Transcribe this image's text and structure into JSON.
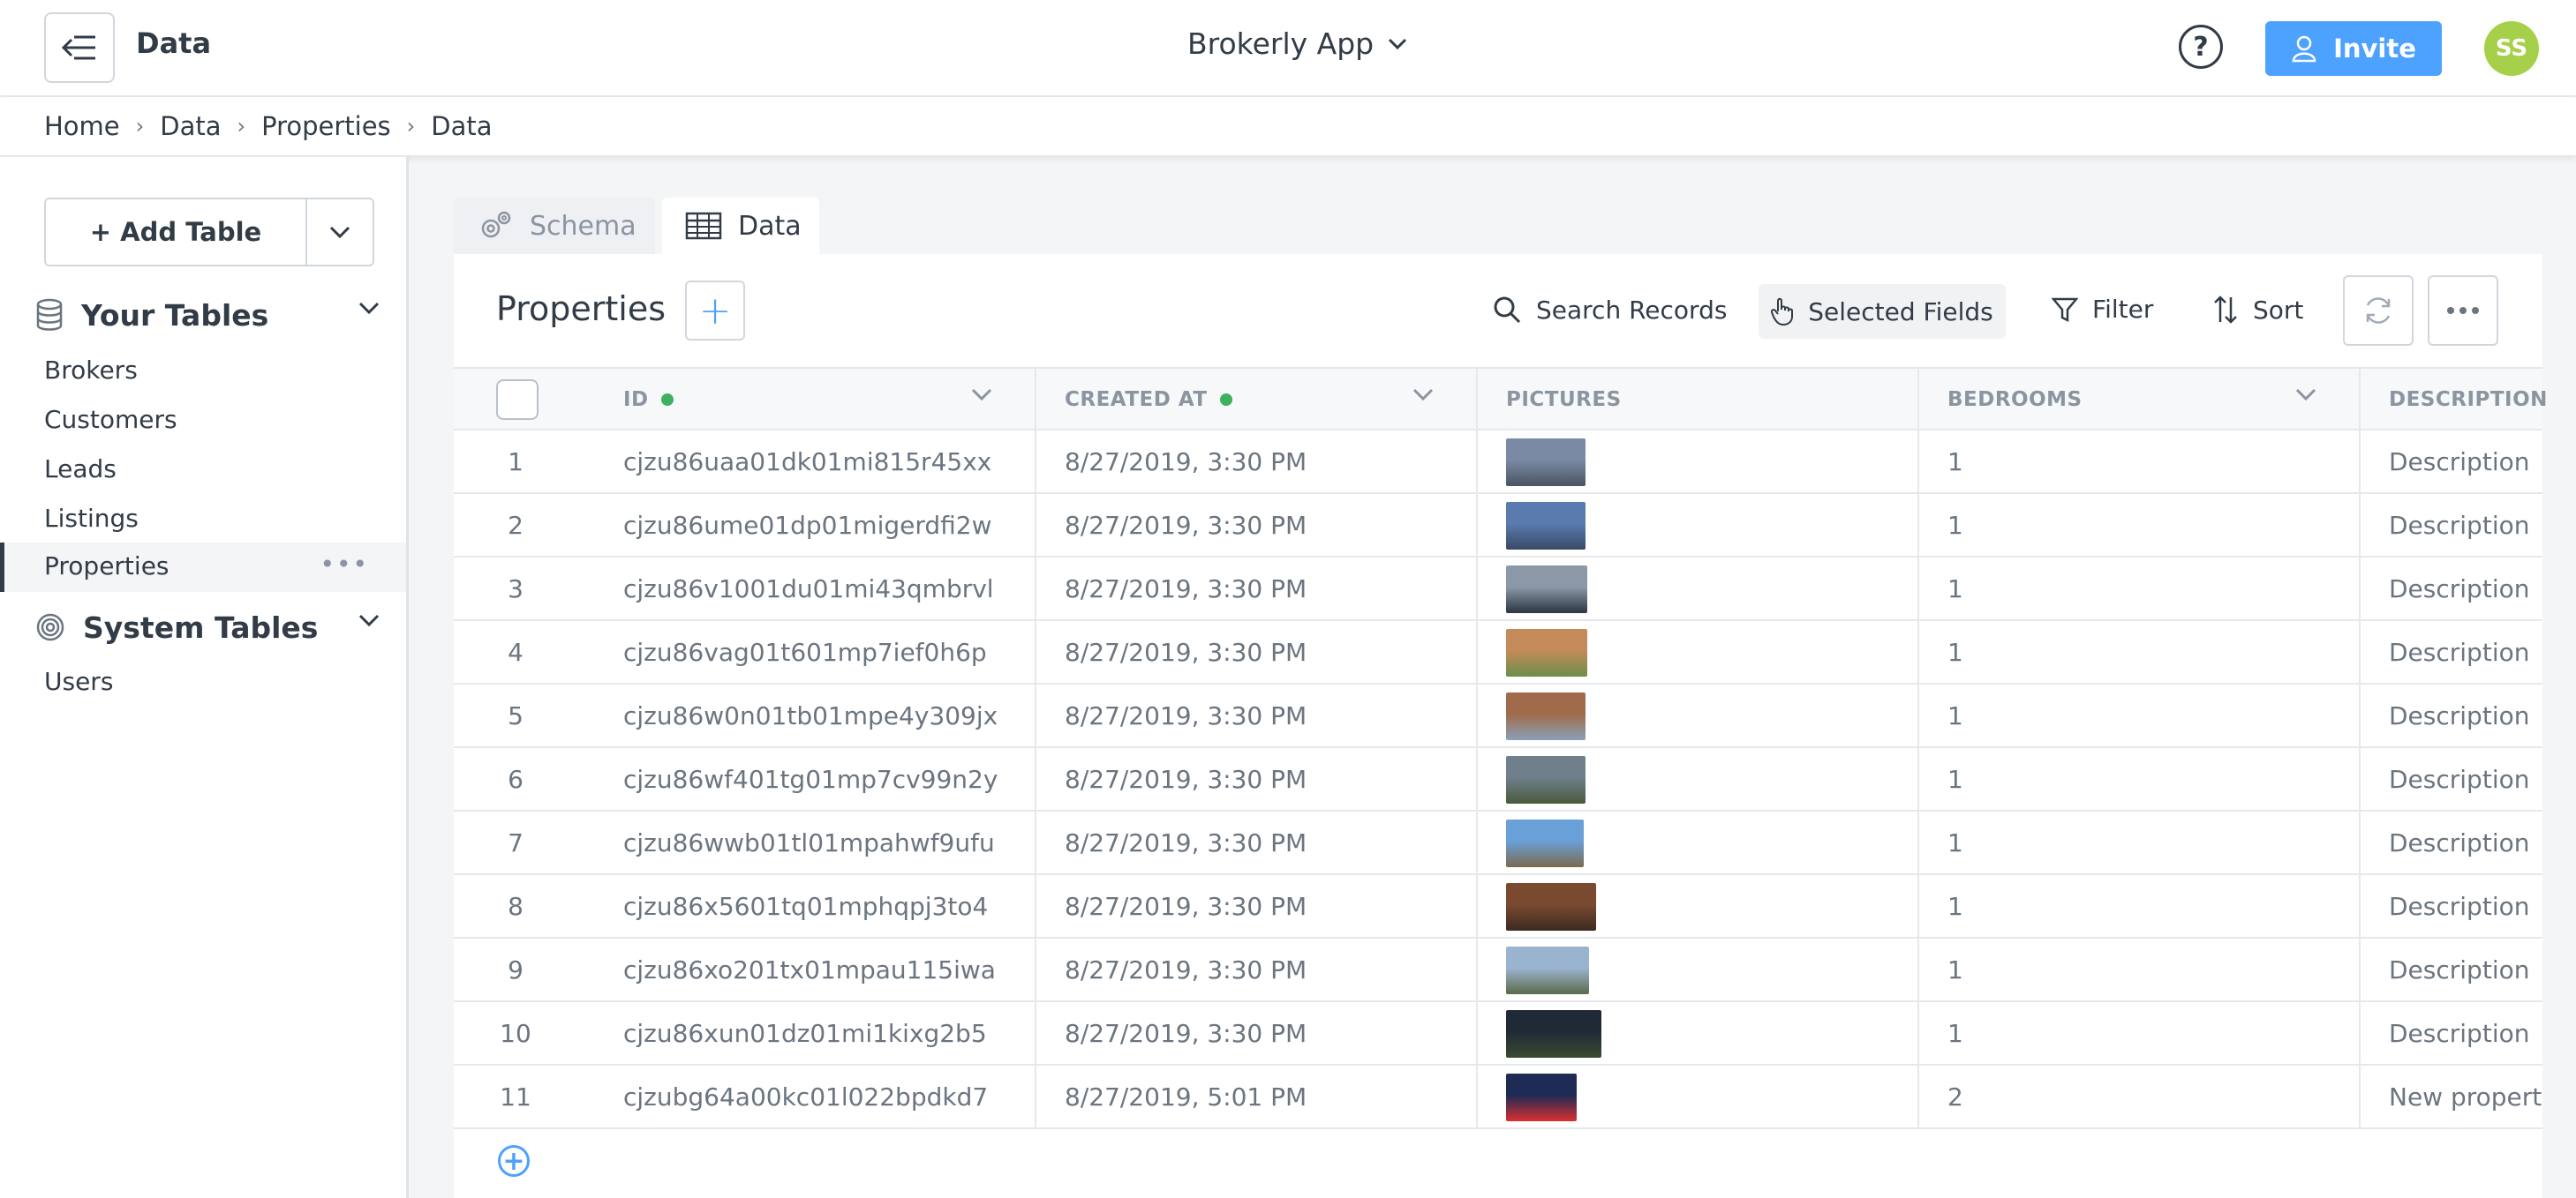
{
  "topbar": {
    "title": "Data",
    "app_name": "Brokerly App",
    "help_label": "?",
    "invite_label": "Invite",
    "avatar_initials": "SS"
  },
  "breadcrumb": [
    "Home",
    "Data",
    "Properties",
    "Data"
  ],
  "sidebar": {
    "add_table_label": "+ Add Table",
    "your_tables_label": "Your Tables",
    "your_tables": [
      "Brokers",
      "Customers",
      "Leads",
      "Listings",
      "Properties"
    ],
    "active_table": "Properties",
    "system_tables_label": "System Tables",
    "system_tables": [
      "Users"
    ]
  },
  "tabs": {
    "schema": "Schema",
    "data": "Data"
  },
  "toolbar": {
    "table_title": "Properties",
    "add_label": "+",
    "search_label": "Search Records",
    "selected_fields_label": "Selected Fields",
    "filter_label": "Filter",
    "sort_label": "Sort"
  },
  "columns": {
    "id": "ID",
    "created_at": "CREATED AT",
    "pictures": "PICTURES",
    "bedrooms": "BEDROOMS",
    "description": "DESCRIPTION"
  },
  "rows": [
    {
      "n": "1",
      "id": "cjzu86uaa01dk01mi815r45xx",
      "created": "8/27/2019, 3:30 PM",
      "bedrooms": "1",
      "description": "Description"
    },
    {
      "n": "2",
      "id": "cjzu86ume01dp01migerdfi2w",
      "created": "8/27/2019, 3:30 PM",
      "bedrooms": "1",
      "description": "Description"
    },
    {
      "n": "3",
      "id": "cjzu86v1001du01mi43qmbrvl",
      "created": "8/27/2019, 3:30 PM",
      "bedrooms": "1",
      "description": "Description"
    },
    {
      "n": "4",
      "id": "cjzu86vag01t601mp7ief0h6p",
      "created": "8/27/2019, 3:30 PM",
      "bedrooms": "1",
      "description": "Description"
    },
    {
      "n": "5",
      "id": "cjzu86w0n01tb01mpe4y309jx",
      "created": "8/27/2019, 3:30 PM",
      "bedrooms": "1",
      "description": "Description"
    },
    {
      "n": "6",
      "id": "cjzu86wf401tg01mp7cv99n2y",
      "created": "8/27/2019, 3:30 PM",
      "bedrooms": "1",
      "description": "Description"
    },
    {
      "n": "7",
      "id": "cjzu86wwb01tl01mpahwf9ufu",
      "created": "8/27/2019, 3:30 PM",
      "bedrooms": "1",
      "description": "Description"
    },
    {
      "n": "8",
      "id": "cjzu86x5601tq01mphqpj3to4",
      "created": "8/27/2019, 3:30 PM",
      "bedrooms": "1",
      "description": "Description"
    },
    {
      "n": "9",
      "id": "cjzu86xo201tx01mpau115iwa",
      "created": "8/27/2019, 3:30 PM",
      "bedrooms": "1",
      "description": "Description"
    },
    {
      "n": "10",
      "id": "cjzu86xun01dz01mi1kixg2b5",
      "created": "8/27/2019, 3:30 PM",
      "bedrooms": "1",
      "description": "Description"
    },
    {
      "n": "11",
      "id": "cjzubg64a00kc01l022bpdkd7",
      "created": "8/27/2019, 5:01 PM",
      "bedrooms": "2",
      "description": "New property"
    }
  ],
  "colors": {
    "accent": "#4da1ff",
    "status_dot": "#3db160",
    "avatar": "#a6d04a"
  }
}
